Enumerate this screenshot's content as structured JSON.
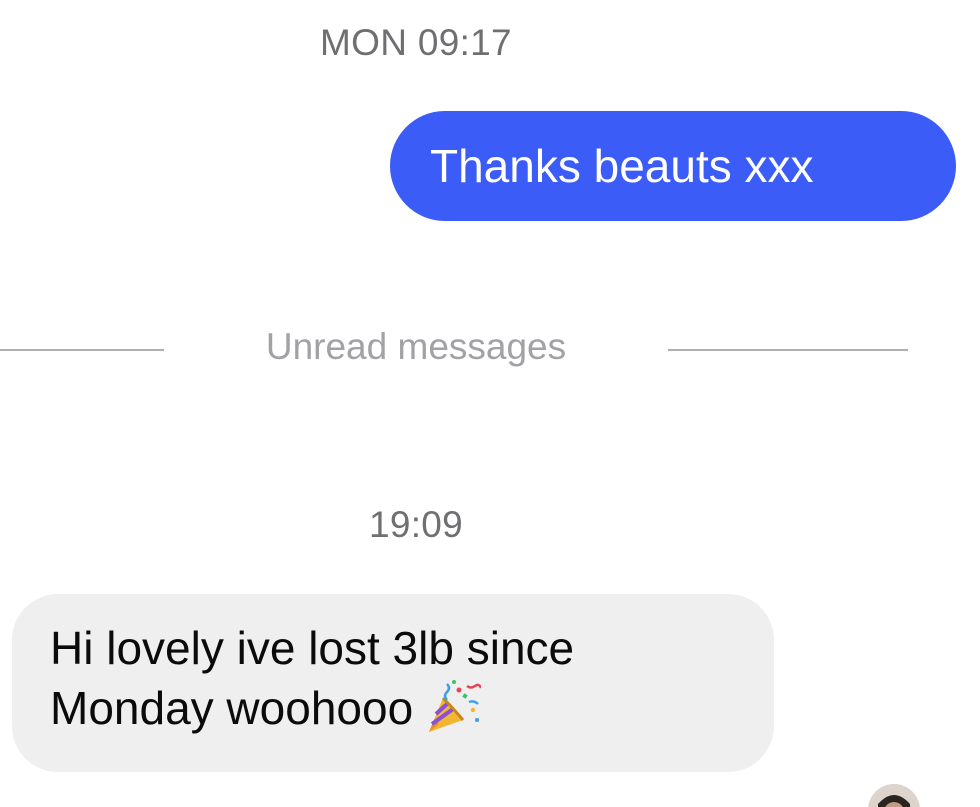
{
  "timestamps": {
    "first": "MON 09:17",
    "second": "19:09"
  },
  "outgoing": {
    "text": "Thanks beauts xxx",
    "color": "#3b5cf6"
  },
  "unread_divider": {
    "label": "Unread messages"
  },
  "incoming": {
    "line1": "Hi lovely ive lost 3lb since",
    "line2": "Monday woohooo",
    "emoji": "party-popper-icon",
    "color": "#efeff0"
  },
  "avatar": {
    "icon": "avatar"
  }
}
